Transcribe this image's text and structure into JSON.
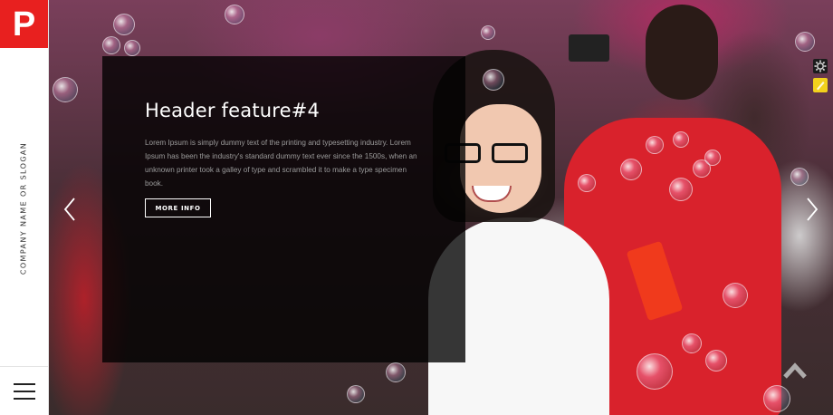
{
  "brand": {
    "logo_letter": "P",
    "slogan": "COMPANY NAME OR SLOGAN",
    "accent_color": "#e8201f"
  },
  "sidebar": {
    "menu_icon": "hamburger-menu-icon"
  },
  "slide": {
    "title": "Header feature#4",
    "text": "Lorem Ipsum is simply dummy text of the printing and typesetting industry. Lorem Ipsum has been the industry's standard dummy text ever since the 1500s, when an unknown printer took a galley of type and scrambled it to make a type specimen book.",
    "button_label": "MORE INFO"
  },
  "controls": {
    "prev_icon": "chevron-left-icon",
    "next_icon": "chevron-right-icon",
    "settings_icon": "gear-icon",
    "color_icon": "color-swatch-icon",
    "scroll_top_icon": "chevron-up-icon"
  }
}
